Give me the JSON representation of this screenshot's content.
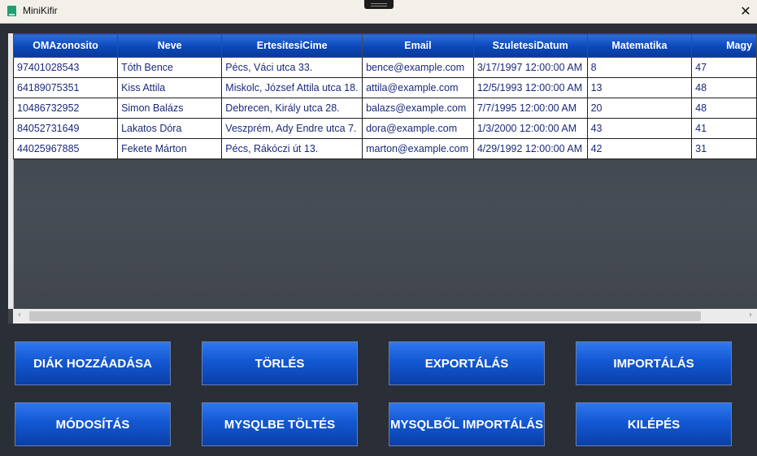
{
  "window": {
    "title": "MiniKifir",
    "close_glyph": "✕"
  },
  "grid": {
    "columns": [
      "OMAzonosito",
      "Neve",
      "ErtesitesiCime",
      "Email",
      "SzuletesiDatum",
      "Matematika",
      "Magy"
    ],
    "rows": [
      [
        "97401028543",
        "Tóth Bence",
        "Pécs, Váci utca 33.",
        "bence@example.com",
        "3/17/1997 12:00:00 AM",
        "8",
        "47"
      ],
      [
        "64189075351",
        "Kiss Attila",
        "Miskolc, József Attila utca 18.",
        "attila@example.com",
        "12/5/1993 12:00:00 AM",
        "13",
        "48"
      ],
      [
        "10486732952",
        "Simon Balázs",
        "Debrecen, Király utca 28.",
        "balazs@example.com",
        "7/7/1995 12:00:00 AM",
        "20",
        "48"
      ],
      [
        "84052731649",
        "Lakatos Dóra",
        "Veszprém, Ady Endre utca 7.",
        "dora@example.com",
        "1/3/2000 12:00:00 AM",
        "43",
        "41"
      ],
      [
        "44025967885",
        "Fekete Márton",
        "Pécs, Rákóczi út 13.",
        "marton@example.com",
        "4/29/1992 12:00:00 AM",
        "42",
        "31"
      ]
    ],
    "scroll_left_glyph": "‹",
    "scroll_right_glyph": "›"
  },
  "buttons": {
    "add_student": "DIÁK HOZZÁADÁSA",
    "delete": "TÖRLÉS",
    "export": "EXPORTÁLÁS",
    "import": "IMPORTÁLÁS",
    "modify": "MÓDOSÍTÁS",
    "mysql_upload": "MYSQLBE TÖLTÉS",
    "mysql_import": "MYSQLBŐL IMPORTÁLÁS",
    "exit": "KILÉPÉS"
  },
  "colors": {
    "header_blue": "#0b47b8",
    "button_blue": "#1358d2",
    "cell_text": "#1a2a7a",
    "app_icon": "#1f9e73"
  },
  "icons": {
    "app": "app-icon",
    "close": "close-icon"
  }
}
